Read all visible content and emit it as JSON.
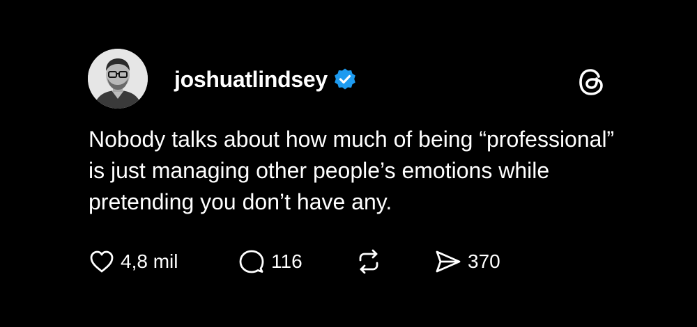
{
  "post": {
    "username": "joshuatlindsey",
    "verified": true,
    "text": "Nobody talks about how much of being “professional” is just managing other people’s emotions while pretending you don’t have any.",
    "actions": {
      "likes": "4,8 mil",
      "replies": "116",
      "shares": "370"
    }
  },
  "icons": {
    "verified_badge": "verified-badge-icon",
    "threads_logo": "threads-logo-icon",
    "like": "heart-icon",
    "reply": "speech-bubble-icon",
    "repost": "repost-arrows-icon",
    "share": "paper-plane-icon"
  },
  "colors": {
    "background": "#000000",
    "text": "#ffffff",
    "verified": "#1d9bf0"
  }
}
